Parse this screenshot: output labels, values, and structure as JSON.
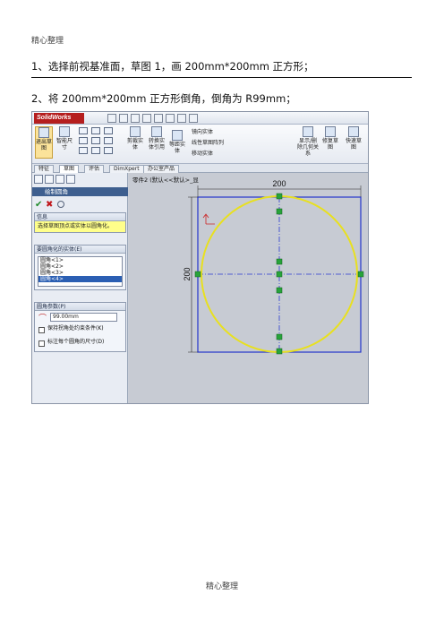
{
  "header": "精心整理",
  "footer": "精心整理",
  "steps": [
    "1、选择前视基准面，草图 1，画 200mm*200mm 正方形；",
    "2、将 200mm*200mm 正方形倒角，倒角为 R99mm；"
  ],
  "app": {
    "logo": "SolidWorks",
    "ribbon": {
      "sketch": "退出草图",
      "smart_dim": "智能尺寸",
      "trim": "剪裁实体",
      "convert": "转换实体引用",
      "offset": "等距实体",
      "mirror": "镜向实体",
      "linear_pattern": "线性草图阵列",
      "move": "移动实体",
      "relations": "显示/删除几何关系",
      "repair": "修复草图",
      "rapid": "快速草图"
    },
    "tabs": [
      "特征",
      "草图",
      "评估",
      "DimXpert",
      "办公室产品"
    ],
    "active_tab": "草图",
    "panel": {
      "title": "绘制圆角",
      "ok_icon": "checkmark-icon",
      "cancel_icon": "close-icon",
      "message_header": "信息",
      "message": "选择草图顶点或实体以圆角化。",
      "entities_header": "要圆角化的实体(E)",
      "entities": [
        "圆角<1>",
        "圆角<2>",
        "圆角<3>",
        "圆角<4>"
      ],
      "params_header": "圆角参数(P)",
      "radius": "99.00mm",
      "keep_corners": "保持拐角处约束条件(K)",
      "dim_each": "标注每个圆角的尺寸(D)"
    },
    "canvas": {
      "tree_label": "零件2  (默认<<默认>_显",
      "dim_h": "200",
      "dim_v": "200"
    }
  }
}
